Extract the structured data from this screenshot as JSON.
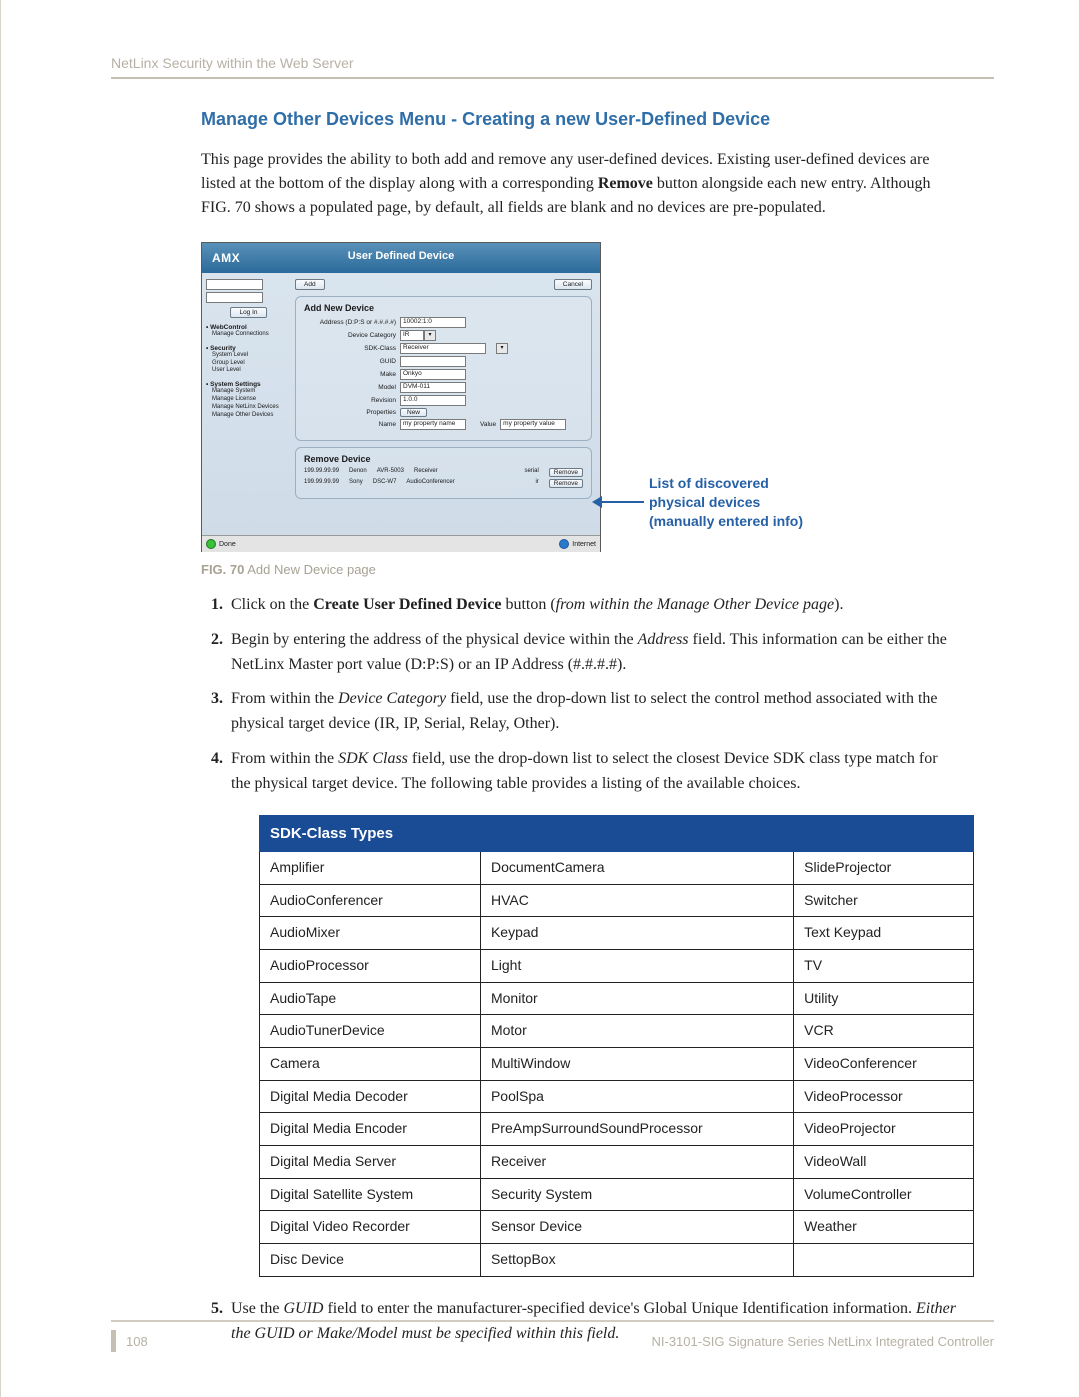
{
  "header_runner": "NetLinx Security within the Web Server",
  "section_title": "Manage Other Devices Menu - Creating a new User-Defined Device",
  "intro_parts": {
    "p1a": "This page provides the ability to both add and remove any user-defined devices. Existing user-defined devices are listed at the bottom of the display along with a corresponding ",
    "p1_bold": "Remove",
    "p1b": " button alongside each new entry. Although FIG. 70 shows a populated page, by default, all fields are blank and no devices are pre-populated."
  },
  "screenshot": {
    "logo": "AMX",
    "title": "User Defined Device",
    "add_btn": "Add",
    "cancel_btn": "Cancel",
    "login_btn": "Log In",
    "sidebar": {
      "g1_head": "• WebControl",
      "g1_items": [
        "Manage Connections"
      ],
      "g2_head": "• Security",
      "g2_items": [
        "System Level",
        "Group Level",
        "User Level"
      ],
      "g3_head": "• System Settings",
      "g3_items": [
        "Manage System",
        "Manage License",
        "Manage NetLinx Devices",
        "Manage Other Devices"
      ]
    },
    "panel_add": {
      "title": "Add New Device",
      "addr_label": "Address (D:P:S or #.#.#.#)",
      "addr_val": "10002:1:0",
      "cat_label": "Device Category",
      "cat_val": "IR",
      "sdk_label": "SDK-Class",
      "sdk_val": "Receiver",
      "guid_label": "GUID",
      "guid_val": "",
      "make_label": "Make",
      "make_val": "Onkyo",
      "model_label": "Model",
      "model_val": "DVM-011",
      "rev_label": "Revision",
      "rev_val": "1.0.0",
      "props_label": "Properties",
      "props_new": "New",
      "name_label": "Name",
      "name_val": "my property name",
      "value_label": "Value",
      "value_val": "my property value"
    },
    "panel_remove": {
      "title": "Remove Device",
      "rows": [
        {
          "ip": "199.99.99.99",
          "make": "Denon",
          "model": "AVR-5003",
          "type": "Receiver",
          "rev": "serial",
          "btn": "Remove"
        },
        {
          "ip": "199.99.99.99",
          "make": "Sony",
          "model": "DSC-W7",
          "type": "AudioConferencer",
          "rev": "ir",
          "btn": "Remove"
        }
      ]
    },
    "status_done": "Done",
    "status_net": "Internet"
  },
  "annotation": {
    "l1": "List of discovered",
    "l2": "physical devices",
    "l3": "(manually entered info)"
  },
  "fig_caption_bold": "FIG. 70",
  "fig_caption_text": "  Add New Device page",
  "steps": {
    "s1a": "Click on the ",
    "s1_bold": "Create User Defined Device",
    "s1b": " button (",
    "s1_it": "from within the Manage Other Device page",
    "s1c": ").",
    "s2a": "Begin by entering the address of the physical device within the ",
    "s2_it": "Address",
    "s2b": " field. This information can be either the NetLinx Master port value (D:P:S) or an IP Address (#.#.#.#).",
    "s3a": "From within the ",
    "s3_it": "Device Category",
    "s3b": " field, use the drop-down list to select the control method associated with the physical target device (IR, IP, Serial, Relay, Other).",
    "s4a": "From within the ",
    "s4_it": "SDK Class",
    "s4b": " field, use the drop-down list to select the closest Device SDK class type match for the physical target device. The following table provides a listing of the available choices.",
    "s5a": "Use the ",
    "s5_it1": "GUID",
    "s5b": " field to enter the manufacturer-specified device's Global Unique Identification information. ",
    "s5_it2": "Either the GUID or Make/Model must be specified within this field."
  },
  "table": {
    "header": "SDK-Class Types",
    "rows": [
      [
        "Amplifier",
        "DocumentCamera",
        "SlideProjector"
      ],
      [
        "AudioConferencer",
        "HVAC",
        "Switcher"
      ],
      [
        "AudioMixer",
        "Keypad",
        "Text Keypad"
      ],
      [
        "AudioProcessor",
        "Light",
        "TV"
      ],
      [
        "AudioTape",
        "Monitor",
        "Utility"
      ],
      [
        "AudioTunerDevice",
        "Motor",
        "VCR"
      ],
      [
        "Camera",
        "MultiWindow",
        "VideoConferencer"
      ],
      [
        "Digital Media Decoder",
        "PoolSpa",
        "VideoProcessor"
      ],
      [
        "Digital Media Encoder",
        "PreAmpSurroundSoundProcessor",
        "VideoProjector"
      ],
      [
        "Digital Media Server",
        "Receiver",
        "VideoWall"
      ],
      [
        "Digital Satellite System",
        "Security System",
        "VolumeController"
      ],
      [
        "Digital Video Recorder",
        "Sensor Device",
        "Weather"
      ],
      [
        "Disc Device",
        "SettopBox",
        ""
      ]
    ]
  },
  "footer": {
    "page_no": "108",
    "right": "NI-3101-SIG Signature Series NetLinx Integrated Controller"
  }
}
